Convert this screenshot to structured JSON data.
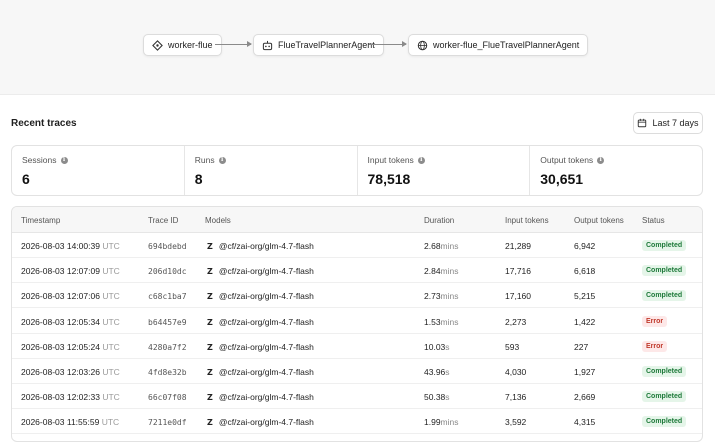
{
  "flow": {
    "nodes": [
      {
        "label": "worker-flue",
        "icon": "diamond-icon"
      },
      {
        "label": "FlueTravelPlannerAgent",
        "icon": "robot-icon"
      },
      {
        "label": "worker-flue_FlueTravelPlannerAgent",
        "icon": "globe-icon"
      }
    ]
  },
  "traces": {
    "title": "Recent traces",
    "range_label": "Last 7 days"
  },
  "stats": [
    {
      "label": "Sessions",
      "value": "6"
    },
    {
      "label": "Runs",
      "value": "8"
    },
    {
      "label": "Input tokens",
      "value": "78,518"
    },
    {
      "label": "Output tokens",
      "value": "30,651"
    }
  ],
  "table": {
    "headers": [
      "Timestamp",
      "Trace ID",
      "Models",
      "Duration",
      "Input tokens",
      "Output tokens",
      "Status"
    ],
    "rows": [
      {
        "ts": "2026-08-03 14:00:39",
        "tz": "UTC",
        "id": "694bdebd",
        "model": "@cf/zai-org/glm-4.7-flash",
        "dur": "2.68",
        "unit": "mins",
        "in": "21,289",
        "out": "6,942",
        "status": "Completed"
      },
      {
        "ts": "2026-08-03 12:07:09",
        "tz": "UTC",
        "id": "206d10dc",
        "model": "@cf/zai-org/glm-4.7-flash",
        "dur": "2.84",
        "unit": "mins",
        "in": "17,716",
        "out": "6,618",
        "status": "Completed"
      },
      {
        "ts": "2026-08-03 12:07:06",
        "tz": "UTC",
        "id": "c68c1ba7",
        "model": "@cf/zai-org/glm-4.7-flash",
        "dur": "2.73",
        "unit": "mins",
        "in": "17,160",
        "out": "5,215",
        "status": "Completed"
      },
      {
        "ts": "2026-08-03 12:05:34",
        "tz": "UTC",
        "id": "b64457e9",
        "model": "@cf/zai-org/glm-4.7-flash",
        "dur": "1.53",
        "unit": "mins",
        "in": "2,273",
        "out": "1,422",
        "status": "Error"
      },
      {
        "ts": "2026-08-03 12:05:24",
        "tz": "UTC",
        "id": "4280a7f2",
        "model": "@cf/zai-org/glm-4.7-flash",
        "dur": "10.03",
        "unit": "s",
        "in": "593",
        "out": "227",
        "status": "Error"
      },
      {
        "ts": "2026-08-03 12:03:26",
        "tz": "UTC",
        "id": "4fd8e32b",
        "model": "@cf/zai-org/glm-4.7-flash",
        "dur": "43.96",
        "unit": "s",
        "in": "4,030",
        "out": "1,927",
        "status": "Completed"
      },
      {
        "ts": "2026-08-03 12:02:33",
        "tz": "UTC",
        "id": "66c07f08",
        "model": "@cf/zai-org/glm-4.7-flash",
        "dur": "50.38",
        "unit": "s",
        "in": "7,136",
        "out": "2,669",
        "status": "Completed"
      },
      {
        "ts": "2026-08-03 11:55:59",
        "tz": "UTC",
        "id": "7211e0df",
        "model": "@cf/zai-org/glm-4.7-flash",
        "dur": "1.99",
        "unit": "mins",
        "in": "3,592",
        "out": "4,315",
        "status": "Completed"
      }
    ]
  },
  "colors": {
    "completed_bg": "#e5f5e9",
    "completed_fg": "#1e7a3a",
    "error_bg": "#fde8e8",
    "error_fg": "#c0392b"
  }
}
